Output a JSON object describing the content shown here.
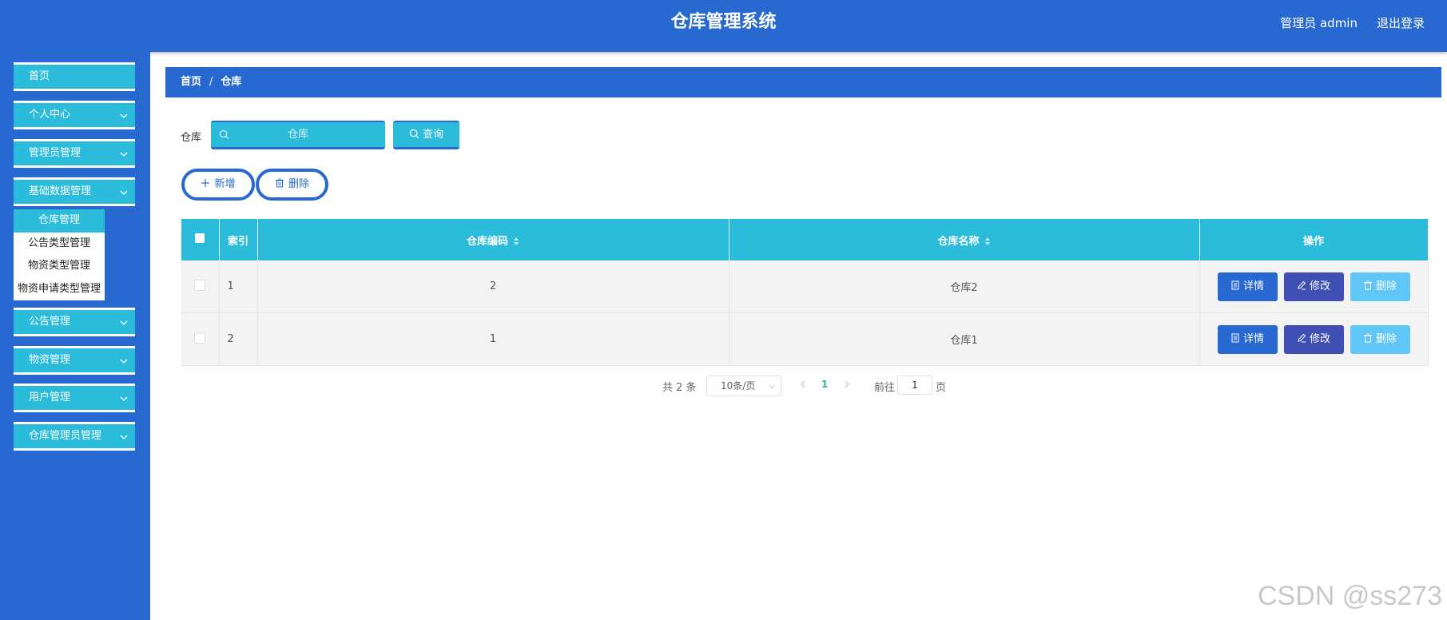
{
  "header": {
    "title": "仓库管理系统",
    "user": "管理员 admin",
    "logout": "退出登录"
  },
  "sidebar": {
    "items": [
      {
        "label": "首页"
      },
      {
        "label": "个人中心"
      },
      {
        "label": "管理员管理"
      },
      {
        "label": "基础数据管理"
      },
      {
        "label": "公告管理"
      },
      {
        "label": "物资管理"
      },
      {
        "label": "用户管理"
      },
      {
        "label": "仓库管理员管理"
      }
    ],
    "submenu": [
      {
        "label": "仓库管理"
      },
      {
        "label": "公告类型管理"
      },
      {
        "label": "物资类型管理"
      },
      {
        "label": "物资申请类型管理"
      }
    ]
  },
  "breadcrumb": {
    "home": "首页",
    "separator": "/",
    "current": "仓库"
  },
  "search": {
    "label": "仓库",
    "placeholder": "仓库",
    "button": "查询"
  },
  "actions": {
    "add": "新增",
    "delete": "删除"
  },
  "table": {
    "headers": {
      "index": "索引",
      "code": "仓库编码",
      "name": "仓库名称",
      "ops": "操作"
    },
    "rows": [
      {
        "index": "1",
        "code": "2",
        "name": "仓库2"
      },
      {
        "index": "2",
        "code": "1",
        "name": "仓库1"
      }
    ],
    "ops": {
      "detail": "详情",
      "edit": "修改",
      "delete": "删除"
    }
  },
  "pagination": {
    "total": "共 2 条",
    "page_size": "10条/页",
    "current": "1",
    "goto_label": "前往",
    "goto_value": "1",
    "page_suffix": "页"
  },
  "watermark": "CSDN @ss273",
  "colors": {
    "primary": "#2769d0",
    "accent": "#2bbcdc",
    "edit": "#3f4fb3",
    "danger_light": "#5fc6f6"
  }
}
